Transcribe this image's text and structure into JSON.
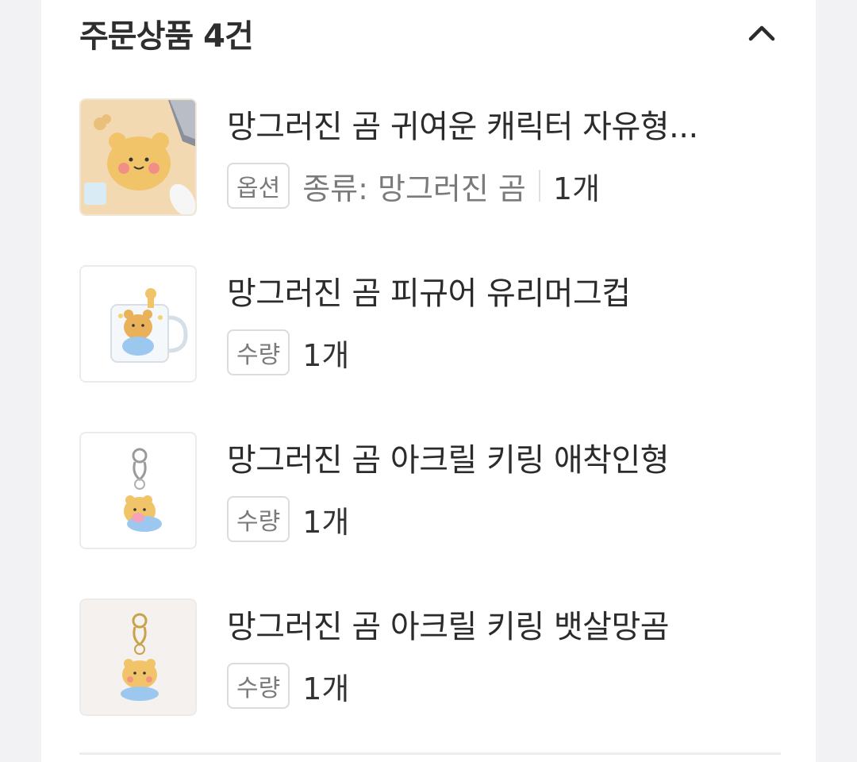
{
  "section": {
    "title": "주문상품 4건",
    "collapse_icon": "chevron-up-icon"
  },
  "items": [
    {
      "name": "망그러진 곰 귀여운 캐릭터 자유형...",
      "badge": "옵션",
      "option": "종류: 망그러진 곰",
      "qty": "1개",
      "thumb_icon": "bear-mousepad-image"
    },
    {
      "name": "망그러진 곰 피규어 유리머그컵",
      "badge": "수량",
      "qty": "1개",
      "thumb_icon": "bear-glass-mug-image"
    },
    {
      "name": "망그러진 곰 아크릴 키링 애착인형",
      "badge": "수량",
      "qty": "1개",
      "thumb_icon": "bear-keyring-doll-image"
    },
    {
      "name": "망그러진 곰 아크릴 키링 뱃살망곰",
      "badge": "수량",
      "qty": "1개",
      "thumb_icon": "bear-keyring-belly-image"
    }
  ],
  "colors": {
    "background": "#f2f2f5",
    "card": "#ffffff",
    "text": "#2b2b2b",
    "muted": "#7a7a7a",
    "border": "#dcdcdc"
  }
}
